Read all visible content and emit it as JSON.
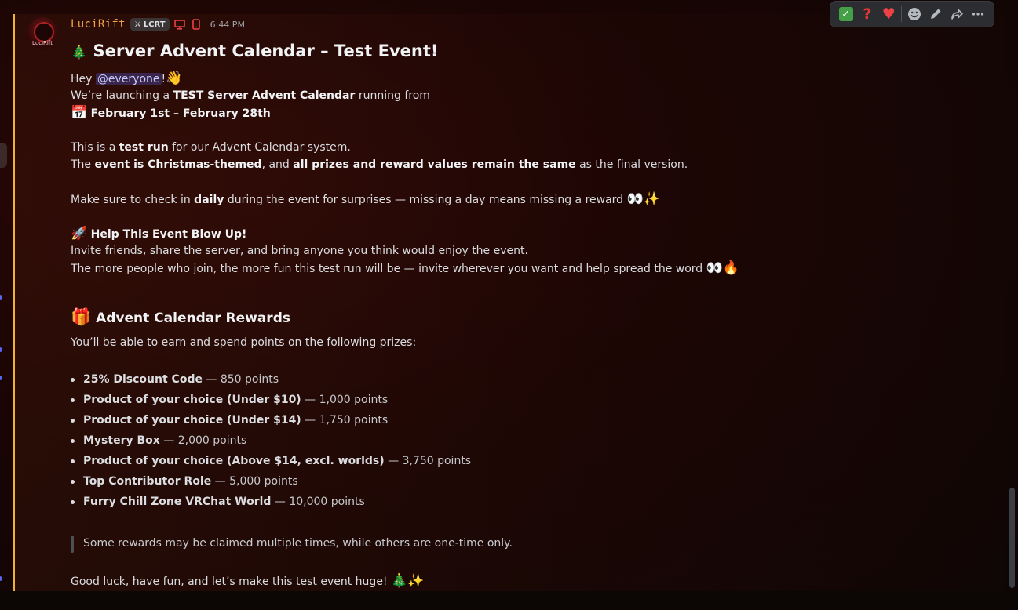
{
  "author": {
    "username": "LuciRift",
    "avatar_text": "LuciRift",
    "tag": "LCRT",
    "timestamp": "6:44 PM"
  },
  "message": {
    "title_emoji": "🎄",
    "title": "Server Advent Calendar – Test Event!",
    "greeting_prefix": "Hey ",
    "mention": "@everyone",
    "greeting_suffix": "!",
    "wave_emoji": "👋",
    "launch_prefix": "We’re launching a ",
    "launch_bold": "TEST Server Advent Calendar",
    "launch_suffix": " running from",
    "date_emoji": "📅",
    "date_range": "February 1st – February 28th",
    "test_run_prefix": "This is a ",
    "test_run_bold": "test run",
    "test_run_suffix": " for our Advent Calendar system.",
    "theme_prefix": "The ",
    "theme_bold": "event is Christmas-themed",
    "theme_mid": ", and ",
    "theme_bold2": "all prizes and reward values remain the same",
    "theme_suffix": " as the final version.",
    "daily_prefix": "Make sure to check in ",
    "daily_bold": "daily",
    "daily_suffix": " during the event for surprises — missing a day means missing a reward ",
    "daily_emoji": "👀✨",
    "help_emoji": "🚀",
    "help_title": "Help This Event Blow Up!",
    "invite_line": "Invite friends, share the server, and bring anyone you think would enjoy the event.",
    "people_line": "The more people who join, the more fun this test run will be — invite wherever you want and help spread the word ",
    "people_emoji": "👀🔥",
    "rewards_emoji": "🎁",
    "rewards_title": "Advent Calendar Rewards",
    "rewards_intro": "You’ll be able to earn and spend points on the following prizes:",
    "rewards": [
      {
        "name": "25% Discount Code",
        "points": " — 850 points"
      },
      {
        "name": "Product of your choice (Under $10)",
        "points": " — 1,000 points"
      },
      {
        "name": "Product of your choice (Under $14)",
        "points": " — 1,750 points"
      },
      {
        "name": "Mystery Box",
        "points": " — 2,000 points"
      },
      {
        "name": "Product of your choice (Above $14, excl. worlds)",
        "points": " — 3,750 points"
      },
      {
        "name": "Top Contributor Role",
        "points": " — 5,000 points"
      },
      {
        "name": "Furry Chill Zone VRChat World",
        "points": " — 10,000 points"
      }
    ],
    "quote": "Some rewards may be claimed multiple times, while others are one-time only.",
    "closing": "Good luck, have fun, and let’s make this test event huge! ",
    "closing_emoji": "🎄✨"
  },
  "toolbar": {
    "reaction_1": "✓",
    "reaction_2": "?",
    "reaction_3": "♥",
    "add_reaction_icon": "smiley-icon",
    "edit_icon": "pencil-icon",
    "forward_icon": "forward-arrow-icon",
    "more_icon": "more-dots-icon"
  },
  "colors": {
    "username": "#f1a14a",
    "mention_bar": "#f0b232",
    "device_icons": "#ed4245"
  }
}
